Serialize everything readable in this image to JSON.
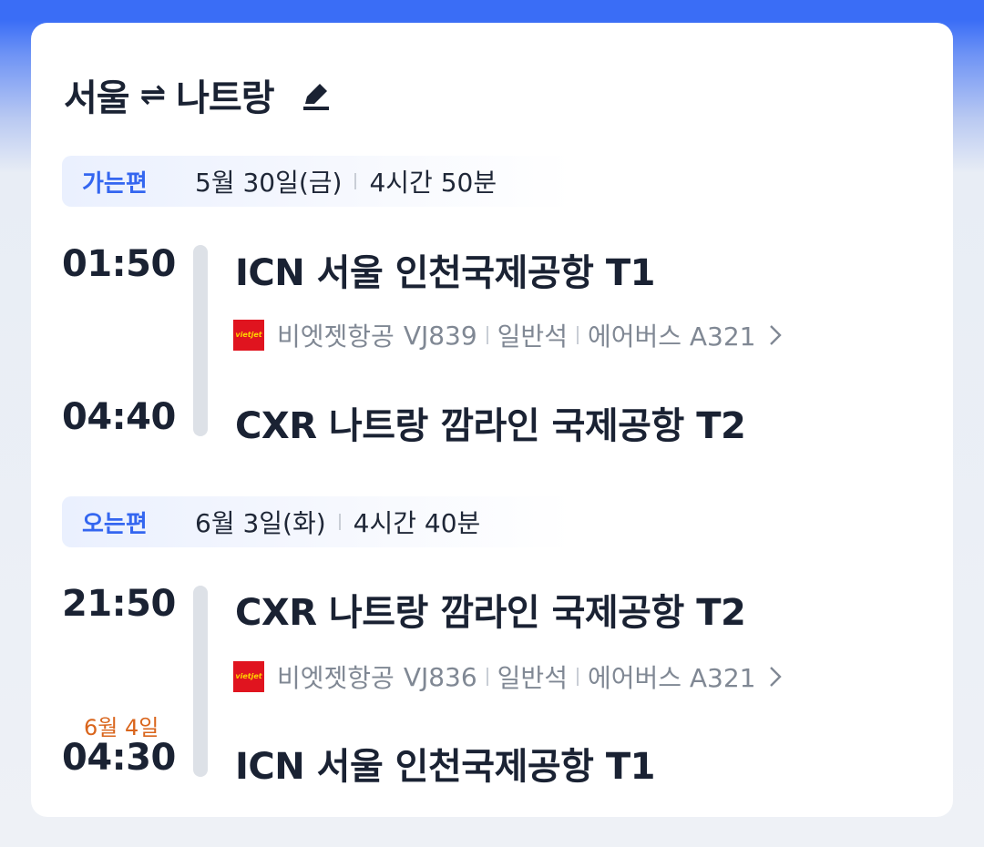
{
  "route": {
    "origin": "서울",
    "swap_symbol": "⇌",
    "destination": "나트랑"
  },
  "outbound": {
    "label": "가는편",
    "date": "5월 30일(금)",
    "duration": "4시간 50분",
    "depart_time": "01:50",
    "depart_airport": "ICN 서울 인천국제공항 T1",
    "airline": "비엣젯항공",
    "flight_no": "VJ839",
    "cabin": "일반석",
    "aircraft": "에어버스 A321",
    "arrive_time": "04:40",
    "arrive_airport": "CXR 나트랑 깜라인 국제공항 T2"
  },
  "inbound": {
    "label": "오는편",
    "date": "6월 3일(화)",
    "duration": "4시간 40분",
    "depart_time": "21:50",
    "depart_airport": "CXR 나트랑 깜라인 국제공항 T2",
    "airline": "비엣젯항공",
    "flight_no": "VJ836",
    "cabin": "일반석",
    "aircraft": "에어버스 A321",
    "arrive_date_note": "6월 4일",
    "arrive_time": "04:30",
    "arrive_airport": "ICN 서울 인천국제공항 T1"
  },
  "airline_logo_text": "vietjetAir.com",
  "colors": {
    "accent": "#3466f0",
    "next_day": "#d9651c",
    "airline_logo": "#e0141f",
    "header_bar": "#3a6df6"
  },
  "icons": {
    "edit": "pencil-icon",
    "swap": "swap-arrows-icon",
    "chevron": "chevron-right-icon"
  }
}
